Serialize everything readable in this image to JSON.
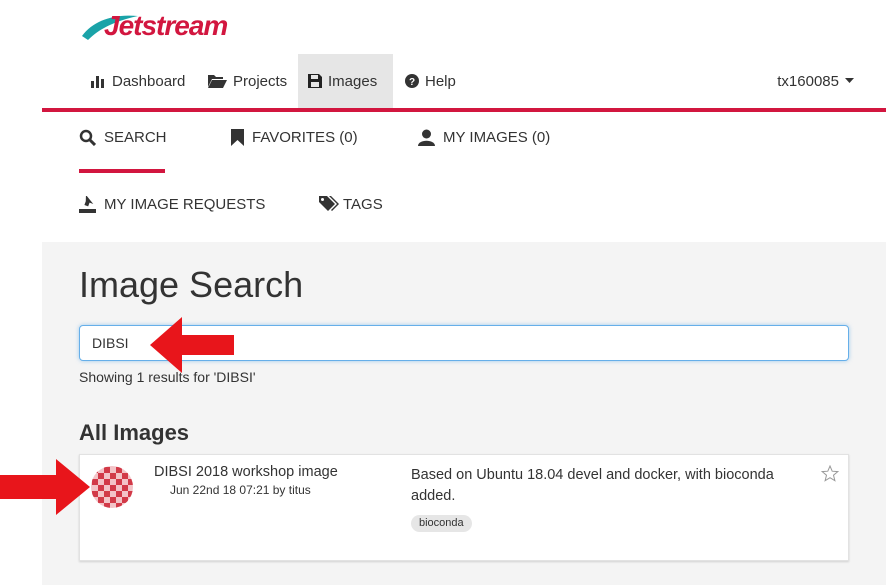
{
  "brand": {
    "name": "Jetstream",
    "color": "#d2163f"
  },
  "topnav": {
    "items": [
      {
        "label": "Dashboard",
        "icon": "bar-chart-icon"
      },
      {
        "label": "Projects",
        "icon": "folder-open-icon"
      },
      {
        "label": "Images",
        "icon": "floppy-disk-icon",
        "active": true
      },
      {
        "label": "Help",
        "icon": "question-circle-icon"
      }
    ],
    "user": "tx160085"
  },
  "subtabs": [
    {
      "label": "SEARCH",
      "icon": "search-icon",
      "active": true
    },
    {
      "label": "FAVORITES (0)",
      "icon": "bookmark-icon"
    },
    {
      "label": "MY IMAGES (0)",
      "icon": "user-icon"
    },
    {
      "label": "MY IMAGE REQUESTS",
      "icon": "upload-icon"
    },
    {
      "label": "TAGS",
      "icon": "tags-icon"
    }
  ],
  "page": {
    "title": "Image Search",
    "search_value": "DIBSI",
    "result_text": "Showing 1 results for 'DIBSI'",
    "section_title": "All Images"
  },
  "results": [
    {
      "name": "DIBSI 2018 workshop image",
      "meta": "Jun 22nd 18 07:21 by titus",
      "description": "Based on Ubuntu 18.04 devel and docker, with bioconda added.",
      "tags": [
        "bioconda"
      ]
    }
  ],
  "annotation_color": "#e8151b"
}
